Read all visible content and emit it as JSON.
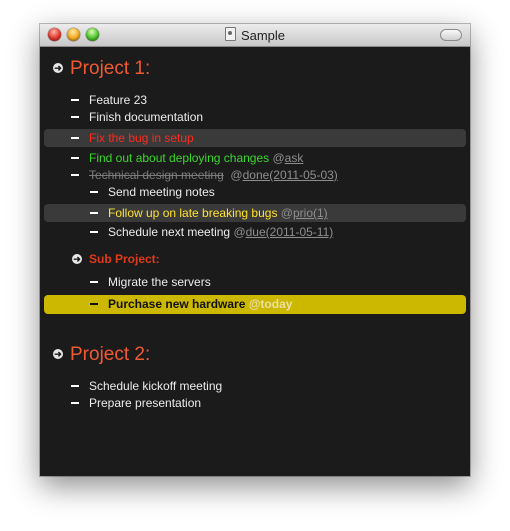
{
  "window": {
    "title": "Sample"
  },
  "projects": [
    {
      "title": "Project 1:"
    },
    {
      "title": "Project 2:"
    }
  ],
  "subproject": {
    "title": "Sub Project:"
  },
  "tasks": {
    "feature23": "Feature 23",
    "finish_docs": "Finish documentation",
    "fix_bug": "Fix the bug in setup",
    "deploy": "Find out about deploying changes",
    "deploy_tag_at": "@",
    "deploy_tag": "ask",
    "tech_design": "Technical design meeting",
    "tech_tag_at": "@",
    "tech_tag": "done(2011-05-03)",
    "send_notes": "Send meeting notes",
    "follow_up": "Follow up on late breaking bugs",
    "follow_tag_at": "@",
    "follow_tag": "prio(1)",
    "schedule_next": "Schedule next meeting",
    "schedule_tag_at": "@",
    "schedule_tag": "due(2011-05-11)",
    "migrate": "Migrate the servers",
    "purchase": "Purchase new hardware",
    "purchase_tag": "@today",
    "kickoff": "Schedule kickoff meeting",
    "presentation": "Prepare presentation"
  },
  "colors": {
    "project": "#f05a32",
    "fix_bug": "#ff2a1e",
    "deploy": "#3ad82c",
    "follow_up": "#ffe22c",
    "today_highlight": "#cdb800",
    "background": "#1b1b1b"
  },
  "icons": {
    "close": "close-icon",
    "minimize": "minimize-icon",
    "zoom": "zoom-icon",
    "document": "document-icon",
    "toolbar_toggle": "toolbar-toggle-icon",
    "bullet": "arrow-bullet-icon"
  }
}
